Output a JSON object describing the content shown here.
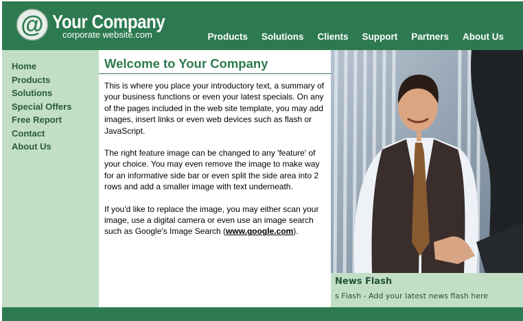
{
  "header": {
    "logo_symbol": "@",
    "company_name": "Your Company",
    "tagline": "corporate website.com",
    "nav": [
      "Products",
      "Solutions",
      "Clients",
      "Support",
      "Partners",
      "About Us"
    ]
  },
  "sidebar": {
    "items": [
      "Home",
      "Products",
      "Solutions",
      "Special Offers",
      "Free Report",
      "Contact",
      "About Us"
    ]
  },
  "main": {
    "title": "Welcome to Your Company",
    "paragraph_1": "This is where you place your introductory text, a summary of your business functions or even your latest specials. On any of the pages included in the web site template, you may add images, insert links or even web devices such as flash or JavaScript.",
    "paragraph_2": "The right feature image can be changed to any 'feature' of your choice. You may even remove the image to make way for an informative side bar or even split the side area into 2 rows and add a smaller image with text underneath.",
    "paragraph_3_pre": "If you'd like to replace the image, you may either scan your image, use a digital camera or even use an image search such as Google's Image Search (",
    "paragraph_3_link": "www.google.com",
    "paragraph_3_post": ")."
  },
  "feature_image": {
    "icon": "business-handshake-photo"
  },
  "news": {
    "title": "News Flash",
    "ticker": "s Flash - Add your latest news flash here"
  },
  "colors": {
    "brand_green": "#2d7a50",
    "light_green": "#c2dfc5",
    "nav_text": "#2b5a38"
  }
}
